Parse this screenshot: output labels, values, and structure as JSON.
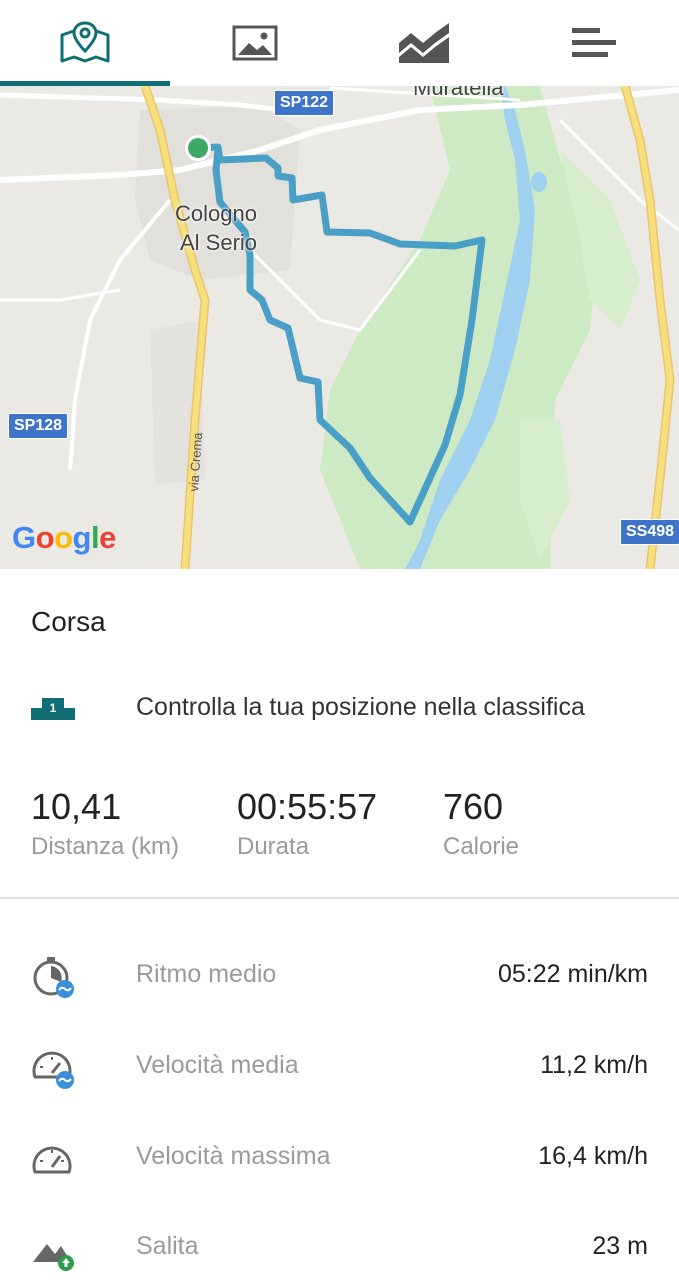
{
  "tabs": [
    {
      "name": "map-tab",
      "icon": "map-pin-icon",
      "active": true
    },
    {
      "name": "photos-tab",
      "icon": "image-icon",
      "active": false
    },
    {
      "name": "charts-tab",
      "icon": "area-chart-icon",
      "active": false
    },
    {
      "name": "details-tab",
      "icon": "menu-lines-icon",
      "active": false
    }
  ],
  "map": {
    "town_label_line1": "Cologno",
    "town_label_line2": "Al Serio",
    "town_label_top": "Muratella",
    "road_sp122": "SP122",
    "road_sp128": "SP128",
    "road_ss498": "SS498",
    "street_name": "via Crema",
    "provider": "Google"
  },
  "activity": {
    "type": "Corsa",
    "leaderboard_text": "Controlla la tua posizione nella classifica",
    "leaderboard_rank": "1"
  },
  "summary": {
    "distance_value": "10,41",
    "distance_label": "Distanza (km)",
    "duration_value": "00:55:57",
    "duration_label": "Durata",
    "calories_value": "760",
    "calories_label": "Calorie"
  },
  "metrics": [
    {
      "label": "Ritmo medio",
      "value": "05:22 min/km",
      "icon": "avg-pace-icon"
    },
    {
      "label": "Velocità media",
      "value": "11,2 km/h",
      "icon": "avg-speed-icon"
    },
    {
      "label": "Velocità massima",
      "value": "16,4 km/h",
      "icon": "max-speed-icon"
    },
    {
      "label": "Salita",
      "value": "23 m",
      "icon": "ascent-icon"
    }
  ],
  "colors": {
    "accent": "#0e6e74",
    "route": "#4a9fc6",
    "water": "#9fd0ef",
    "park": "#cdeac4",
    "road_major": "#f6d86a",
    "badge_blue": "#3a8fd8",
    "badge_green": "#2e9e4a"
  }
}
